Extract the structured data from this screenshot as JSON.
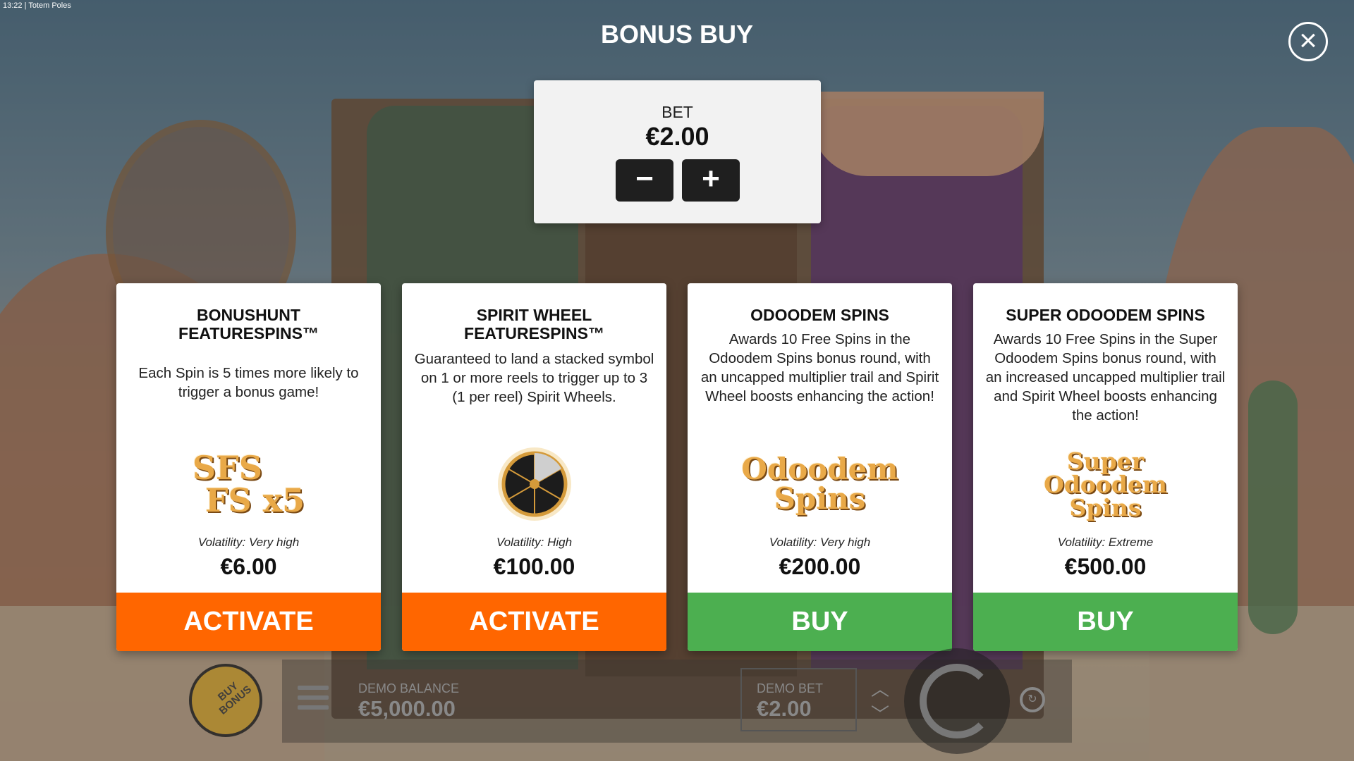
{
  "status_bar": {
    "time": "13:22",
    "separator": "|",
    "app_name": "Totem Poles"
  },
  "dialog": {
    "title": "BONUS BUY",
    "close_icon": "close-icon"
  },
  "bet": {
    "label": "BET",
    "value": "€2.00",
    "decrease_label": "−",
    "increase_label": "+"
  },
  "cards": [
    {
      "title": "BONUSHUNT FEATURESPINS™",
      "description": "Each Spin is 5 times more likely to trigger a bonus game!",
      "art_icon": "sfs-fs-x5-logo-icon",
      "art_text": [
        "SFS",
        "FS x5"
      ],
      "volatility": "Volatility: Very high",
      "price": "€6.00",
      "action": "ACTIVATE",
      "action_color": "#ff6600"
    },
    {
      "title": "SPIRIT WHEEL FEATURESPINS™",
      "description": "Guaranteed to land a stacked symbol on 1 or more reels to trigger up to 3 (1 per reel) Spirit Wheels.",
      "art_icon": "spirit-wheel-icon",
      "volatility": "Volatility: High",
      "price": "€100.00",
      "action": "ACTIVATE",
      "action_color": "#ff6600"
    },
    {
      "title": "ODOODEM SPINS",
      "description": "Awards 10 Free Spins in the Odoodem Spins bonus round, with an uncapped multiplier trail and Spirit Wheel boosts enhancing the action!",
      "art_icon": "odoodem-spins-logo-icon",
      "art_text": [
        "Odoodem",
        "Spins"
      ],
      "volatility": "Volatility: Very high",
      "price": "€200.00",
      "action": "BUY",
      "action_color": "#4caf50"
    },
    {
      "title": "SUPER ODOODEM SPINS",
      "description": "Awards 10 Free Spins in the Super Odoodem Spins bonus round, with an increased uncapped multiplier trail and Spirit Wheel boosts enhancing the action!",
      "art_icon": "super-odoodem-spins-logo-icon",
      "art_text": [
        "Super",
        "Odoodem",
        "Spins"
      ],
      "volatility": "Volatility: Extreme",
      "price": "€500.00",
      "action": "BUY",
      "action_color": "#4caf50"
    }
  ],
  "hud": {
    "buy_bonus_label": "BUY BONUS",
    "menu_icon": "hamburger-menu-icon",
    "balance_label": "DEMO BALANCE",
    "balance_value": "€5,000.00",
    "bet_label": "DEMO BET",
    "bet_value": "€2.00",
    "spin_icon": "spin-icon",
    "autoplay_icon": "autoplay-icon"
  }
}
